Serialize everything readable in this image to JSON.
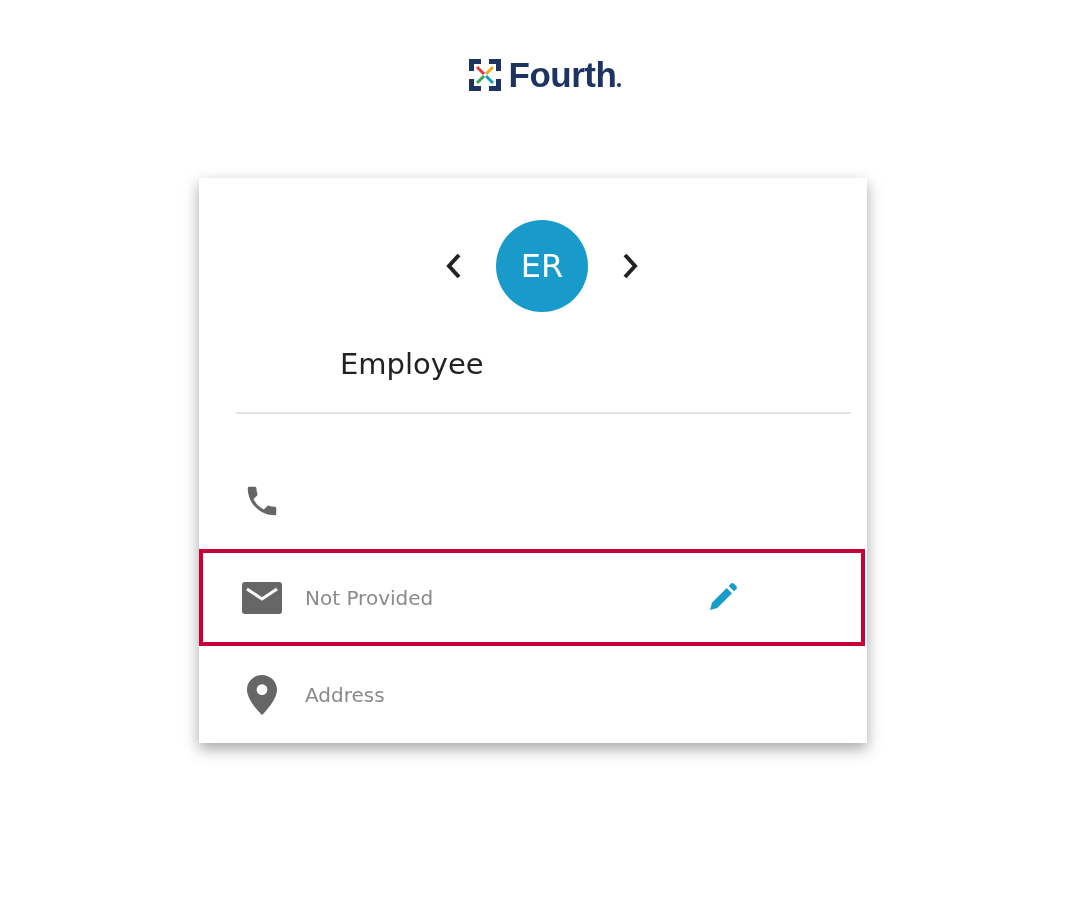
{
  "logo": {
    "text": "Fourth"
  },
  "profile": {
    "initials": "ER",
    "name": "Employee"
  },
  "contacts": [
    {
      "kind": "phone",
      "highlighted": false,
      "editable": false
    },
    {
      "kind": "email",
      "text": "Not Provided",
      "highlighted": true,
      "editable": true
    },
    {
      "kind": "address",
      "text": "Address",
      "highlighted": false,
      "editable": false
    }
  ]
}
